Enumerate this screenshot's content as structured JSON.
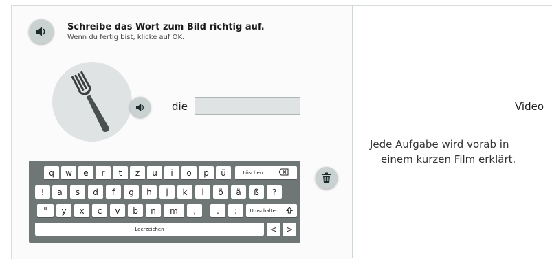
{
  "task": {
    "title": "Schreibe das Wort zum Bild richtig auf.",
    "subtitle": "Wenn du fertig bist, klicke auf OK."
  },
  "exercise": {
    "article": "die",
    "answer_value": "",
    "picture_icon": "fork-icon"
  },
  "keyboard": {
    "rows": [
      [
        "q",
        "w",
        "e",
        "r",
        "t",
        "z",
        "u",
        "i",
        "o",
        "p",
        "ü"
      ],
      [
        "!",
        "a",
        "s",
        "d",
        "f",
        "g",
        "h",
        "j",
        "k",
        "l",
        "ö",
        "ä",
        "ß",
        "?"
      ],
      [
        "\"",
        "y",
        "x",
        "c",
        "v",
        "b",
        "n",
        "m",
        ",",
        ".",
        ":"
      ]
    ],
    "delete_label": "Löschen",
    "shift_label": "Umschalten",
    "space_label": "Leerzeichen",
    "left_arrow": "<",
    "right_arrow": ">"
  },
  "video_panel": {
    "title": "Video",
    "description_line1": "Jede Aufgabe wird vorab in",
    "description_line2": "einem kurzen Film erklärt."
  },
  "icons": {
    "speaker_top": "speaker-icon",
    "speaker_word": "speaker-icon",
    "trash": "trash-icon"
  },
  "colors": {
    "keyboard_bg": "#6f7776",
    "button_bg": "#c9d1d1",
    "input_bg": "#dfe3e3"
  }
}
